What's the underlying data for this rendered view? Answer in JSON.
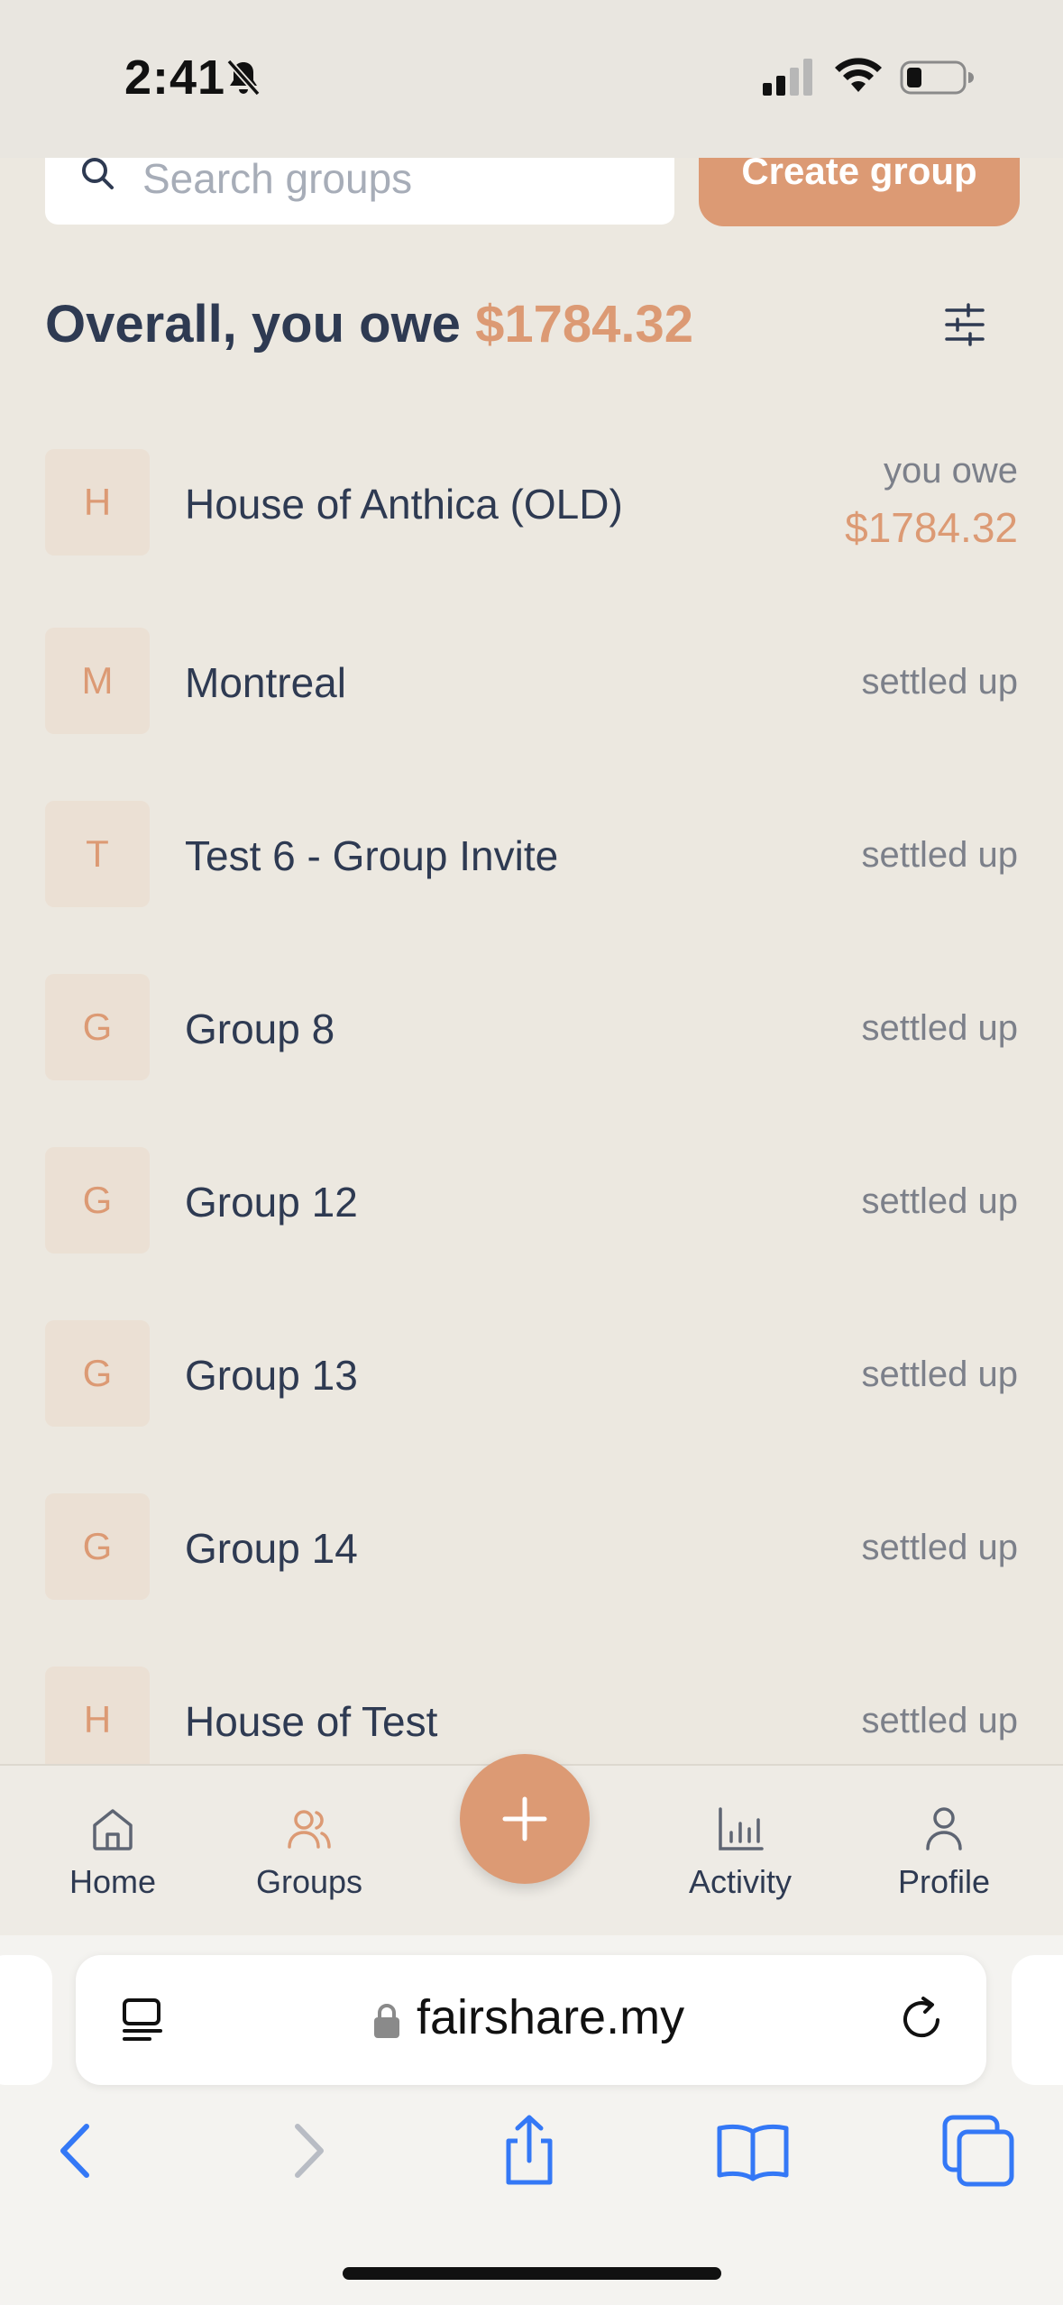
{
  "status_bar": {
    "time": "2:41"
  },
  "search": {
    "placeholder": "Search groups"
  },
  "create_group": {
    "label": "Create group"
  },
  "overall": {
    "prefix": "Overall, you owe",
    "amount": "$1784.32"
  },
  "groups": [
    {
      "initial": "H",
      "name": "House of Anthica (OLD)",
      "status": "you owe",
      "amount": "$1784.32"
    },
    {
      "initial": "M",
      "name": "Montreal",
      "status": "settled up"
    },
    {
      "initial": "T",
      "name": "Test 6 - Group Invite",
      "status": "settled up"
    },
    {
      "initial": "G",
      "name": "Group 8",
      "status": "settled up"
    },
    {
      "initial": "G",
      "name": "Group 12",
      "status": "settled up"
    },
    {
      "initial": "G",
      "name": "Group 13",
      "status": "settled up"
    },
    {
      "initial": "G",
      "name": "Group 14",
      "status": "settled up"
    },
    {
      "initial": "H",
      "name": "House of Test",
      "status": "settled up"
    }
  ],
  "nav": {
    "home": "Home",
    "groups": "Groups",
    "activity": "Activity",
    "profile": "Profile",
    "active": "groups"
  },
  "browser": {
    "url": "fairshare.my"
  },
  "colors": {
    "accent": "#DC9A74",
    "text": "#2E3A52",
    "muted": "#7C808A",
    "background": "#ECE8E0",
    "ios_blue": "#3478F6"
  }
}
